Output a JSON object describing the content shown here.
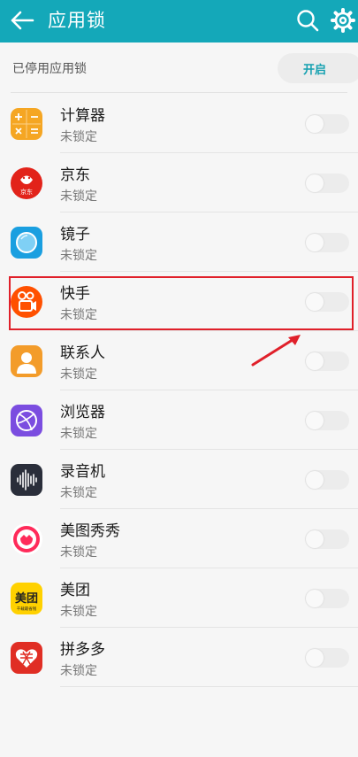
{
  "colors": {
    "accent": "#14a8b9",
    "highlight": "#e0202a"
  },
  "header": {
    "title": "应用锁",
    "icons": [
      "back-arrow-icon",
      "search-icon",
      "gear-icon"
    ]
  },
  "status": {
    "text": "已停用应用锁",
    "button_label": "开启"
  },
  "apps": [
    {
      "name": "计算器",
      "status": "未锁定",
      "icon": "calculator-icon"
    },
    {
      "name": "京东",
      "status": "未锁定",
      "icon": "jd-icon",
      "icon_text": "京东"
    },
    {
      "name": "镜子",
      "status": "未锁定",
      "icon": "mirror-icon"
    },
    {
      "name": "快手",
      "status": "未锁定",
      "icon": "kuaishou-icon"
    },
    {
      "name": "联系人",
      "status": "未锁定",
      "icon": "contacts-icon"
    },
    {
      "name": "浏览器",
      "status": "未锁定",
      "icon": "browser-icon"
    },
    {
      "name": "录音机",
      "status": "未锁定",
      "icon": "recorder-icon"
    },
    {
      "name": "美图秀秀",
      "status": "未锁定",
      "icon": "meitu-icon"
    },
    {
      "name": "美团",
      "status": "未锁定",
      "icon": "meituan-icon",
      "icon_text": "美团",
      "icon_subtext": "千载最省钱"
    },
    {
      "name": "拼多多",
      "status": "未锁定",
      "icon": "pinduoduo-icon"
    }
  ]
}
